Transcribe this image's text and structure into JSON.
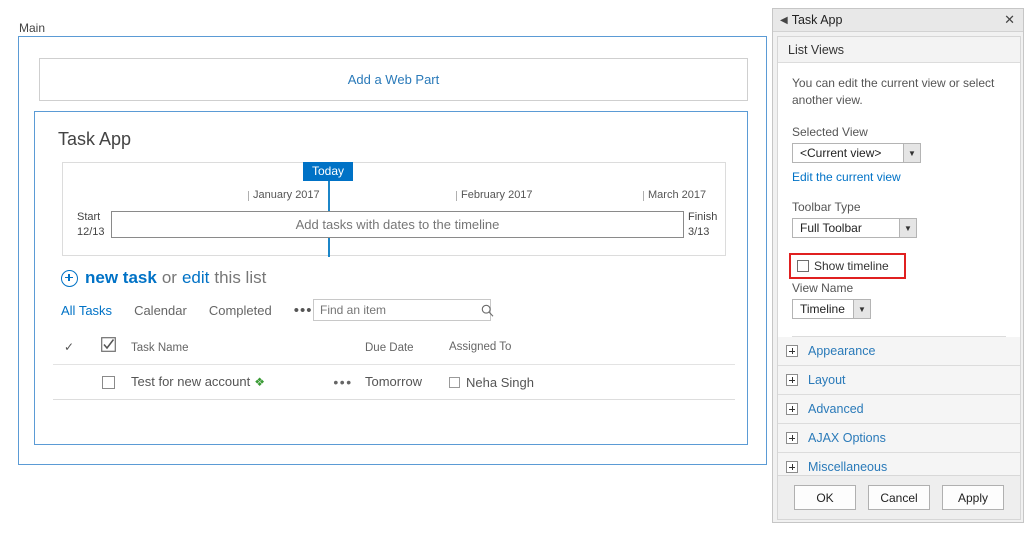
{
  "zone": {
    "label": "Main"
  },
  "add_web_part": {
    "label": "Add a Web Part"
  },
  "webpart": {
    "title": "Task App",
    "timeline": {
      "today_label": "Today",
      "months": [
        "January 2017",
        "February 2017",
        "March 2017"
      ],
      "band_text": "Add tasks with dates to the timeline",
      "start_label": "Start",
      "start_date": "12/13",
      "finish_label": "Finish",
      "finish_date": "3/13"
    },
    "new_task": {
      "plus_icon": "plus-circle-icon",
      "new_task_label": "new task",
      "or_label": "or",
      "edit_label": "edit",
      "tail_label": "this list"
    },
    "view_tabs": [
      {
        "label": "All Tasks",
        "active": true
      },
      {
        "label": "Calendar",
        "active": false
      },
      {
        "label": "Completed",
        "active": false
      }
    ],
    "view_tabs_more": "•••",
    "search": {
      "placeholder": "Find an item",
      "value": "",
      "icon": "search-icon"
    },
    "table": {
      "columns": [
        "",
        "",
        "Task Name",
        "",
        "Due Date",
        "Assigned To"
      ],
      "header_check_icon": "checkmark-icon",
      "header_select_all_icon": "select-all-checkbox-icon",
      "rows": [
        {
          "checkbox": false,
          "name": "Test for new account",
          "new_badge_icon": "new-item-sparkle-icon",
          "ellipsis": "•••",
          "due_date": "Tomorrow",
          "assigned_to": "Neha Singh"
        }
      ]
    }
  },
  "tool_pane": {
    "back_icon": "chevron-left-icon",
    "title": "Task App",
    "close_icon": "close-icon",
    "section_title": "List Views",
    "description": "You can edit the current view or select another view.",
    "selected_view_label": "Selected View",
    "selected_view_value": "<Current view>",
    "edit_current_view_link": "Edit the current view",
    "toolbar_type_label": "Toolbar Type",
    "toolbar_type_value": "Full Toolbar",
    "show_timeline_label": "Show timeline",
    "show_timeline_checked": false,
    "view_name_label": "View Name",
    "view_name_value": "Timeline",
    "accordions": [
      {
        "label": "Appearance"
      },
      {
        "label": "Layout"
      },
      {
        "label": "Advanced"
      },
      {
        "label": "AJAX Options"
      },
      {
        "label": "Miscellaneous"
      }
    ],
    "buttons": {
      "ok": "OK",
      "cancel": "Cancel",
      "apply": "Apply"
    },
    "highlight_color": "#e02020",
    "accent_color": "#0072c6"
  }
}
